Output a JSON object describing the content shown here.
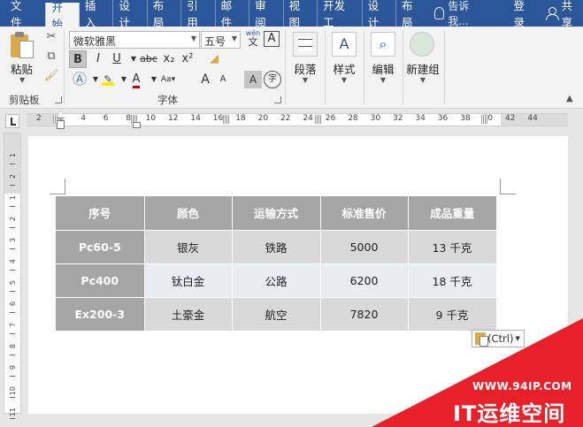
{
  "ribbon_tabs": [
    "文件",
    "开始",
    "插入",
    "设计",
    "布局",
    "引用",
    "邮件",
    "审阅",
    "视图",
    "开发工",
    "设计",
    "布局"
  ],
  "tell_me": "告诉我...",
  "login": "登录",
  "share": "共享",
  "clipboard": {
    "paste": "粘贴",
    "group": "剪贴板"
  },
  "font": {
    "name": "微软雅黑",
    "size": "五号",
    "wen": "wén",
    "wen_char": "文",
    "A_box": "A",
    "bold": "B",
    "italic": "I",
    "underline": "U",
    "strike": "abc",
    "subscript": "x₂",
    "superscript": "x²",
    "grow": "A",
    "shrink": "A",
    "shade": "A",
    "circle_char": "字",
    "group": "字体"
  },
  "commands": {
    "paragraph": "段落",
    "styles": "样式",
    "editing": "编辑",
    "new_group": "新建组"
  },
  "ruler": {
    "ticks": [
      "2",
      "2",
      "4",
      "6",
      "8",
      "10",
      "12",
      "14",
      "16",
      "18",
      "20",
      "22",
      "24",
      "26",
      "28",
      "30",
      "32",
      "34",
      "36",
      "38",
      "40",
      "42",
      "44"
    ],
    "vticks": [
      "1",
      "2",
      "1",
      "2",
      "3",
      "4",
      "5",
      "6",
      "7",
      "8",
      "9",
      "10",
      "11",
      "12"
    ]
  },
  "table": {
    "headers": [
      "序号",
      "颜色",
      "运输方式",
      "标准售价",
      "成品重量"
    ],
    "rows": [
      [
        "Pc60-5",
        "银灰",
        "铁路",
        "5000",
        "13 千克"
      ],
      [
        "Pc400",
        "钛白金",
        "公路",
        "6200",
        "18 千克"
      ],
      [
        "Ex200-3",
        "土豪金",
        "航空",
        "7820",
        "9 千克"
      ]
    ]
  },
  "paste_options": "(Ctrl)",
  "watermark": {
    "url": "WWW.94IP.COM",
    "brand": "IT运维空间"
  },
  "colors": {
    "ribbon_blue": "#2b579a",
    "header_gray": "#a5a5a5",
    "watermark_red": "#e8202a"
  }
}
